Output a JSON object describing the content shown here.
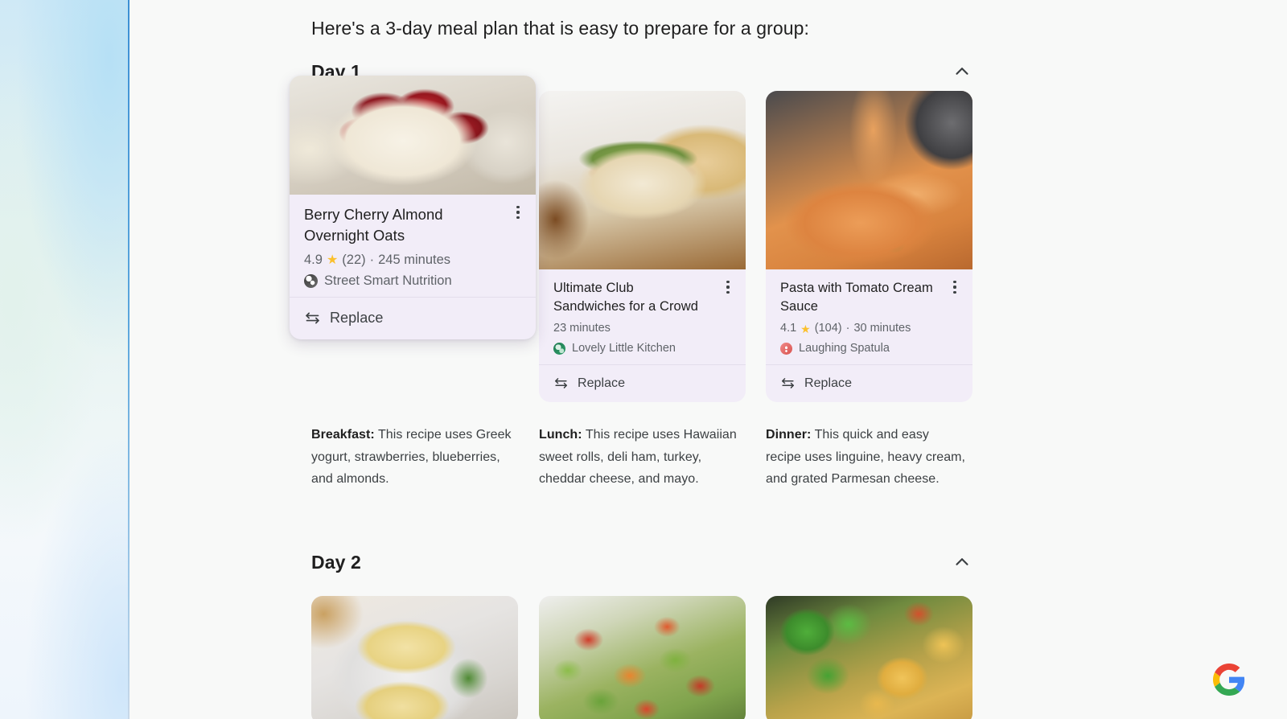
{
  "intro": {
    "text": "Here's a 3-day meal plan that is easy to prepare for a group:"
  },
  "icons": {
    "chevron_up": "chevron-up-icon",
    "kebab": "more-options-icon",
    "swap": "swap-arrows-icon",
    "google_logo": "google-g-logo"
  },
  "colors": {
    "card_background": "#f2edf8",
    "page_background": "#f8f9f8",
    "star": "#fbc02d",
    "divider": "#e3ddeb",
    "text_primary": "#1f1f1f",
    "text_secondary": "#5f6368",
    "rail_border": "#3b8fd4"
  },
  "days": [
    {
      "title": "Day 1",
      "collapse_label": "Collapse Day 1",
      "cards": [
        {
          "title": "Berry Cherry Almond Overnight Oats",
          "rating": "4.9",
          "reviews": "(22)",
          "separator": "·",
          "time": "245 minutes",
          "source": "Street Smart Nutrition",
          "replace_label": "Replace",
          "image_alt": "overnight-oats-photo"
        },
        {
          "title": "Ultimate Club Sandwiches for a Crowd",
          "rating": "",
          "reviews": "",
          "separator": "",
          "time": "23 minutes",
          "source": "Lovely Little Kitchen",
          "replace_label": "Replace",
          "image_alt": "club-sandwich-photo"
        },
        {
          "title": "Pasta with Tomato Cream Sauce",
          "rating": "4.1",
          "reviews": "(104)",
          "separator": "·",
          "time": "30 minutes",
          "source": "Laughing Spatula",
          "replace_label": "Replace",
          "image_alt": "tomato-cream-pasta-photo"
        }
      ],
      "descriptions": [
        {
          "label": "Breakfast:",
          "text": " This recipe uses Greek yogurt, strawberries, blueberries, and almonds."
        },
        {
          "label": "Lunch:",
          "text": " This recipe uses Hawaiian sweet rolls, deli ham, turkey, cheddar cheese, and mayo."
        },
        {
          "label": "Dinner:",
          "text": " This quick and easy recipe uses linguine, heavy cream, and grated Parmesan cheese."
        }
      ]
    },
    {
      "title": "Day 2",
      "collapse_label": "Collapse Day 2",
      "cards": [
        {
          "image_alt": "scrambled-egg-toast-photo"
        },
        {
          "image_alt": "chopped-salad-photo"
        },
        {
          "image_alt": "vegetable-stir-fry-photo"
        }
      ]
    }
  ]
}
